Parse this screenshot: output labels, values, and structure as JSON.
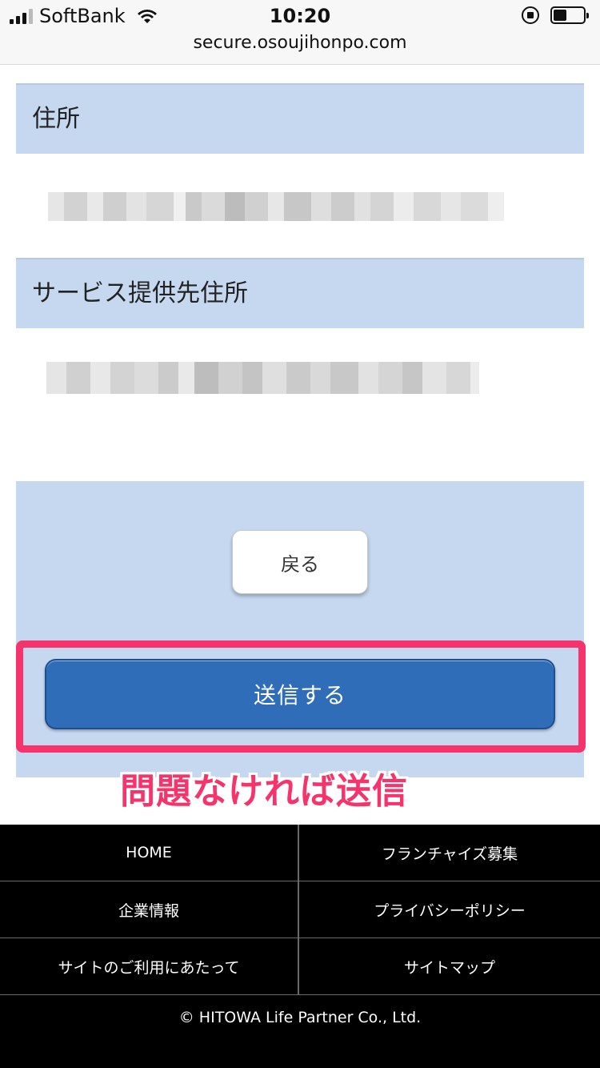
{
  "status_bar": {
    "carrier": "SoftBank",
    "time": "10:20"
  },
  "browser": {
    "url": "secure.osoujihonpo.com"
  },
  "form": {
    "address_label": "住所",
    "service_address_label": "サービス提供先住所"
  },
  "actions": {
    "back_label": "戻る",
    "submit_label": "送信する"
  },
  "annotation": {
    "text": "問題なければ送信",
    "color": "#f7336b"
  },
  "footer": {
    "links": [
      "HOME",
      "フランチャイズ募集",
      "企業情報",
      "プライバシーポリシー",
      "サイトのご利用にあたって",
      "サイトマップ"
    ],
    "copyright": "© HITOWA Life Partner Co., Ltd."
  },
  "colors": {
    "section_header_bg": "#c5d8f0",
    "submit_button": "#2f6db8",
    "footer_bg": "#000000"
  }
}
